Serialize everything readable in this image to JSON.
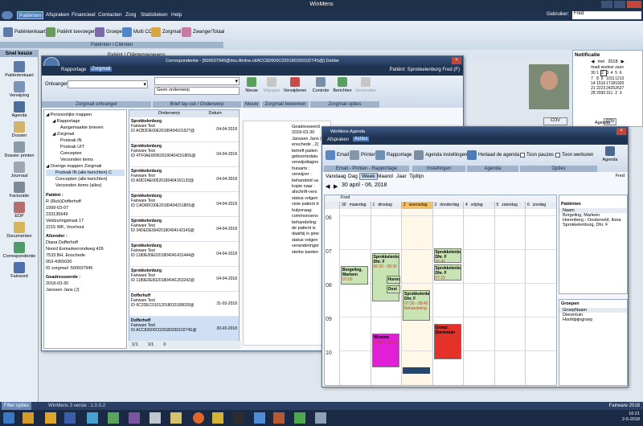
{
  "app": {
    "title": "WinMens",
    "user_label": "Gebruiker:",
    "user_value": "Fred"
  },
  "menu": [
    "Patiënten",
    "Afspraken",
    "Financieel",
    "Contacten",
    "Zorg",
    "Statistieken",
    "Help"
  ],
  "toolbar": {
    "buttons": [
      "Patiëntenkaart",
      "Patiënt toevoegen",
      "Groepen",
      "Multi COV",
      "Zorgmail",
      "ZwangerTotaal"
    ],
    "group_label": "Patiënten / Cliënten"
  },
  "sidebar": {
    "title": "Snel keuze",
    "items": [
      "Patiëntenkaart",
      "Verwijzing",
      "Agenda",
      "Dossier",
      "Dossier printen",
      "Journaal",
      "Facturatie",
      "EDP",
      "Documenten",
      "Correspondentie",
      "Fairword"
    ],
    "filter": "Filter opties"
  },
  "main_tab": "Patiënt / Cliëntengegevens",
  "notif": {
    "title": "Notificatie",
    "month": "mei",
    "year": "2018",
    "days": [
      "ma",
      "di",
      "wo",
      "do",
      "vr",
      "za",
      "zo"
    ],
    "weeks": [
      [
        "30",
        "1",
        "2",
        "3",
        "4",
        "5",
        "6"
      ],
      [
        "7",
        "8",
        "9",
        "10",
        "11",
        "12",
        "13"
      ],
      [
        "14",
        "15",
        "16",
        "17",
        "18",
        "19",
        "20"
      ],
      [
        "21",
        "22",
        "23",
        "24",
        "25",
        "26",
        "27"
      ],
      [
        "28",
        "29",
        "30",
        "31",
        "1",
        "2",
        "3"
      ]
    ],
    "cov": "COV",
    "agenda": "Agenda"
  },
  "corr": {
    "title": "Correspondentie - [500037945@lms.lifeline.nl/ACC82600C02018033010274S@] Debbe",
    "tabs": [
      "Rapportage",
      "Zorgmail"
    ],
    "patient": "Patiënt: Sprokkelenburg Fred (F)",
    "ontvanger_label": "Ontvanger",
    "sender_placeholder": "Geen onderwerp",
    "ribbon": [
      "Nieuw",
      "Wijzigen",
      "Verwijderen",
      "Controle",
      "Berichten",
      "Verzenden"
    ],
    "groups": [
      "Zorgmail ontvanger",
      "Brief lay-out / Onderwerp",
      "Nieuw",
      "Zorgmail bewerken",
      "Zorgmail opties"
    ],
    "tree": [
      "Persoonlijke mappen",
      "Rapportage",
      "Aangemaakte brieven",
      "Zorgmail",
      "Postvak IN",
      "Postvak UIT",
      "Concepten",
      "Verzonden items",
      "Overige mappen Zorgmail",
      "Postvak IN (alle berichten) C",
      "Concepten (alle berichten)",
      "Verzonden items (alles)"
    ],
    "patient_info": [
      "Patiënt :",
      "R (Rick)Dofferhoff",
      "1999-03-07",
      "233135649",
      "Veldzuringstraat 17",
      "2215 WK, Voorhout"
    ],
    "afzender": [
      "Afzender :",
      "Diana Dofferhoff",
      "Noord Esmarkerrondweg 426",
      "7533 BH, Enschede",
      "053-4365030",
      "ID zorgmail :500037945"
    ],
    "geadresseerde": [
      "Geadresseerde :",
      "2018-03-30",
      "Janssen Jans (J)"
    ],
    "col_onderwerp": "Onderwerp",
    "col_datum": "Datum",
    "rows": [
      {
        "n": "Sprokkelenburg",
        "s": "Fairware Test",
        "id": "ID ACB2DE00E2018040410152?@",
        "d": "04-04-2018"
      },
      {
        "n": "Sprokkelenburg",
        "s": "Fairware Test",
        "id": "ID 4TF0AE00962018040415180S@",
        "d": "04-04-2018"
      },
      {
        "n": "Sprokkelenburg",
        "s": "Fairware Test",
        "id": "ID ADD2AE00520180404151133@",
        "d": "04-04-2018"
      },
      {
        "n": "Sprokkelenburg",
        "s": "Fairware Test",
        "id": "ID CAD80C00E2018040415180S@",
        "d": "04-04-2018"
      },
      {
        "n": "Sprokkelenburg",
        "s": "Fairware Test",
        "id": "ID 34DEDE0042018040414314S@",
        "d": "04-04-2018"
      },
      {
        "n": "Sprokkelenburg",
        "s": "Fairware Test",
        "id": "ID 1180E00E0201804041431444@",
        "d": "04-04-2018"
      },
      {
        "n": "Sprokkelenburg",
        "s": "Fairware Test",
        "id": "ID 1180E0E60201804041263242@",
        "d": "04-04-2018"
      },
      {
        "n": "Dofferhoff",
        "s": "Fairware Test",
        "id": "ID 6C2DEC01012018033108020@",
        "d": "31-03-2018"
      },
      {
        "n": "Dofferhoff",
        "s": "Fairware Test",
        "id": "ID ACC82600C02018033010274S@",
        "d": "30-03-2018"
      }
    ],
    "pager": [
      "1/1",
      "1/1",
      "0"
    ],
    "letter": [
      "Geadresseerd",
      "2018-03-30",
      "Janssen Jans (J",
      "enschede , 2(",
      "betreft patien",
      "geboortedatu",
      "verwijsdiagno",
      "huisarts :",
      "verwijzer :",
      "behandeld va",
      "kopie naar :",
      "afschrift-vers",
      "status volgen",
      "visie patient b",
      "hulpvraag:",
      "commonsens",
      "behandeling:",
      "de patient is",
      "daarbij is gew",
      "status volgen",
      "veranderinger",
      "sterke kanten"
    ]
  },
  "agenda": {
    "title": "WinMens Agenda",
    "tabs": [
      "Afspraken",
      "Acties"
    ],
    "ribbon": [
      "Email",
      "Printen",
      "Rapportage",
      "Agenda instellingen",
      "Herlaad de agenda",
      "Toon pauzes",
      "Toon werkuren",
      "Agenda"
    ],
    "groups": [
      "Email - Printen - Rapportage",
      "Instellingen",
      "Agenda",
      "Opties"
    ],
    "views": [
      "Vandaag",
      "Dag",
      "Week",
      "Maand",
      "Jaar",
      "Tijdlijn"
    ],
    "user": "Fred",
    "range": "30 april - 06, 2018",
    "resource": "Fred",
    "days": [
      [
        "30",
        "maandag"
      ],
      [
        "1",
        "dinsdag"
      ],
      [
        "2",
        "woensdag"
      ],
      [
        "3",
        "donderdag"
      ],
      [
        "4",
        "vrijdag"
      ],
      [
        "5",
        "zaterdag"
      ],
      [
        "6",
        "zondag"
      ]
    ],
    "hours": [
      "06",
      "07",
      "08",
      "09",
      "10"
    ],
    "appts": [
      {
        "t": "Borgeling, Marleen",
        "sub": "07:00"
      },
      {
        "t": "Sprokkelenburg, Dhr. F",
        "sub": "06:30 - 09:30"
      },
      {
        "t": "Horen",
        "sub": ""
      },
      {
        "t": "Oost",
        "sub": ""
      },
      {
        "t": "Sprokkelenburg, Dhr. F",
        "sub": "07:30 - 08:45 Behandeling"
      },
      {
        "t": "Sprokkelenburg, Dhr. F",
        "sub": "06:45"
      },
      {
        "t": "Sprokkelenburg, Dhr. F",
        "sub": "07:15"
      },
      {
        "t": "Winsma",
        "sub": "09:30 - 10:30"
      },
      {
        "t": "Groep: Dierentuin",
        "sub": "09:00 - 10:30"
      }
    ],
    "patienten": {
      "title": "Patiënten",
      "col": "Naam",
      "items": [
        "Borgeling, Marleen",
        "Horenberg - Oosterveld, Ilona",
        "Sprokkelenburg, Dhr. F"
      ]
    },
    "groepen": {
      "title": "Groepen",
      "col": "GroepNaam",
      "items": [
        "Dierentuin",
        "Hoofdpijngroep"
      ]
    }
  },
  "status": {
    "version": "WinMens 3 versie : 1.0.0.2",
    "brand": "Fairware 2018",
    "clock": "16:21",
    "date": "2-5-2018"
  }
}
